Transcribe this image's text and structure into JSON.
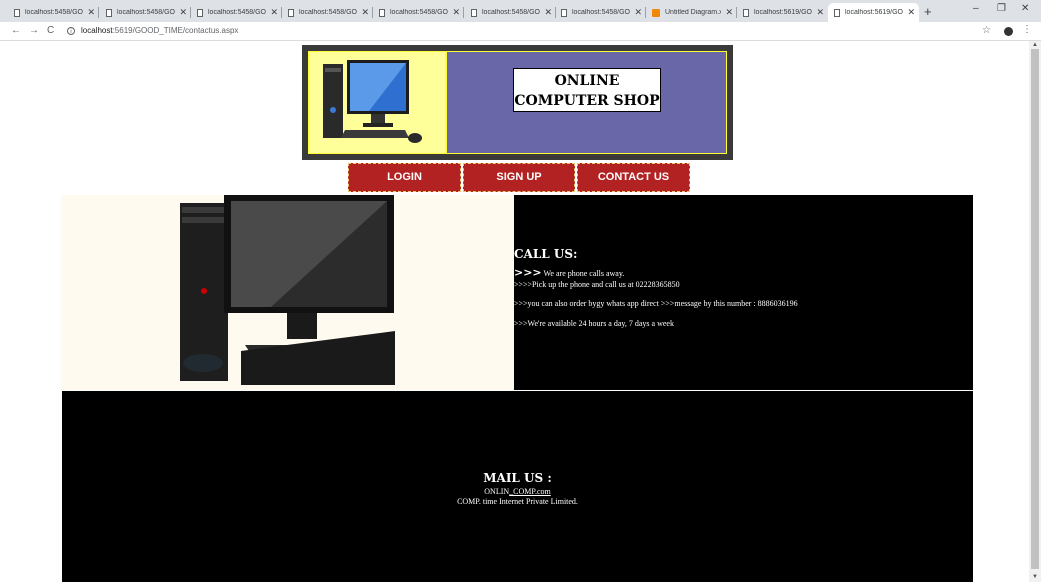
{
  "browser": {
    "tabs": [
      {
        "title": "localhost:5458/GOO",
        "icon": "doc"
      },
      {
        "title": "localhost:5458/GOO",
        "icon": "doc"
      },
      {
        "title": "localhost:5458/GOO",
        "icon": "doc"
      },
      {
        "title": "localhost:5458/GOO",
        "icon": "doc"
      },
      {
        "title": "localhost:5458/GOO",
        "icon": "doc"
      },
      {
        "title": "localhost:5458/GOO",
        "icon": "doc"
      },
      {
        "title": "localhost:5458/GOO",
        "icon": "doc"
      },
      {
        "title": "Untitled Diagram.x",
        "icon": "diagram"
      },
      {
        "title": "localhost:5619/GOO",
        "icon": "doc"
      },
      {
        "title": "localhost:5619/GOO",
        "icon": "doc",
        "active": true
      }
    ],
    "new_tab": "+",
    "url_host": "localhost",
    "url_path": ":5619/GOOD_TIME/contactus.aspx",
    "minimize": "–",
    "restore": "❐",
    "close": "✕"
  },
  "site": {
    "title_line1": "ONLINE",
    "title_line2": "COMPUTER SHOP",
    "menu": {
      "login": "LOGIN",
      "signup": "SIGN UP",
      "contact": "CONTACT US"
    },
    "call": {
      "heading": "CALL US:",
      "arrows": ">>>",
      "line1": " We are phone calls away.",
      "line2": ">>>>Pick up the phone and call us at 02228365850",
      "line3": ">>>you can also order bygy whats app direct >>>message by this number : 8886036196",
      "line4": ">>>We're available 24 hours a day, 7 days a week"
    },
    "mail": {
      "heading": "MAIL US :",
      "addr_prefix": "ONLIN",
      "addr_link": "_COMP.com",
      "company": "COMP. time Internet Private Limited."
    }
  },
  "colors": {
    "header_bg": "#3a3a3a",
    "header_inner": "#6a67a8",
    "menu_bg": "#b22222",
    "accent_yellow": "#ffff33"
  }
}
